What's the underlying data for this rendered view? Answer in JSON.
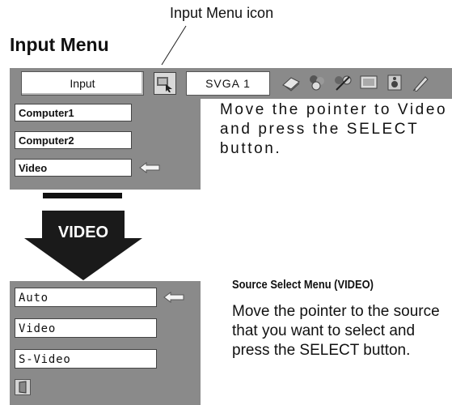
{
  "callout_label": "Input Menu icon",
  "heading": "Input Menu",
  "menubar": {
    "input_label": "Input",
    "resolution_label": "SVGA 1",
    "icons": [
      "input-menu-icon",
      "pc-adjust-icon",
      "image-select-icon",
      "image-adjust-icon",
      "screen-icon",
      "sound-icon",
      "setting-icon"
    ]
  },
  "input_panel": {
    "items": [
      "Computer1",
      "Computer2",
      "Video"
    ],
    "pointer_on": "Video"
  },
  "instruction_1": "Move the pointer to Video and press the SELECT button.",
  "arrow_label": "VIDEO",
  "source_panel": {
    "items": [
      "Auto",
      "Video",
      "S-Video"
    ],
    "pointer_on": "Auto"
  },
  "source_heading": "Source Select Menu (VIDEO)",
  "instruction_2": "Move the pointer to the source that you want to select and press the SELECT button.",
  "colors": {
    "panel": "#8a8a8a",
    "text": "#111111",
    "field": "#ffffff"
  }
}
